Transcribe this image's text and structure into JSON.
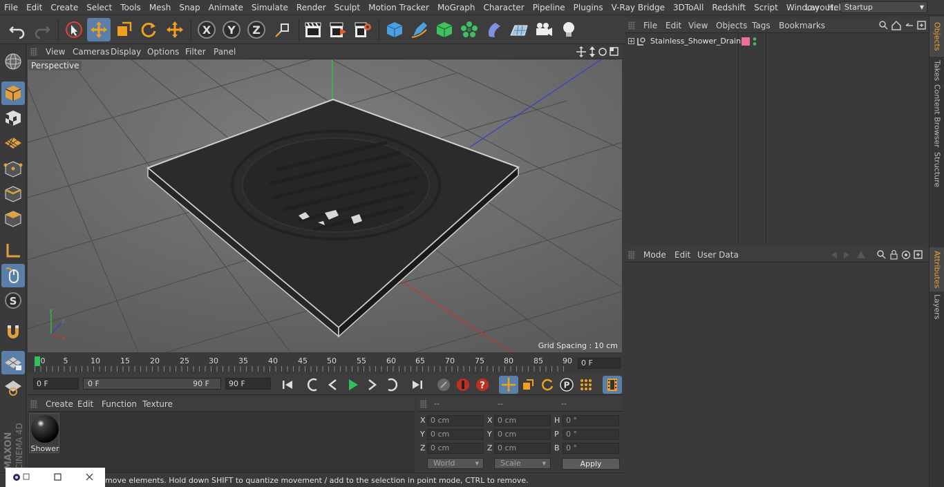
{
  "menu": [
    "File",
    "Edit",
    "Create",
    "Select",
    "Tools",
    "Mesh",
    "Snap",
    "Animate",
    "Simulate",
    "Render",
    "Sculpt",
    "Motion Tracker",
    "MoGraph",
    "Character",
    "Pipeline",
    "Plugins",
    "V-Ray Bridge",
    "3DToAll",
    "Redshift",
    "Script",
    "Window",
    "Help"
  ],
  "layout": {
    "label": "Layout:",
    "value": "Startup"
  },
  "toolbar": {
    "undo": "undo-icon",
    "redo": "redo-icon",
    "axis_x": "X",
    "axis_y": "Y",
    "axis_z": "Z"
  },
  "viewport": {
    "menu": [
      "View",
      "Cameras",
      "Display",
      "Options",
      "Filter",
      "Panel"
    ],
    "camera_label": "Perspective",
    "grid_spacing": "Grid Spacing : 10 cm"
  },
  "timeline": {
    "ticks": [
      "0",
      "5",
      "10",
      "15",
      "20",
      "25",
      "30",
      "35",
      "40",
      "45",
      "50",
      "55",
      "60",
      "65",
      "70",
      "75",
      "80",
      "85",
      "90"
    ],
    "current_frame": "0 F"
  },
  "transport": {
    "start_field": "0 F",
    "range_start": "0 F",
    "range_end": "90 F",
    "end_field": "90 F"
  },
  "materials": {
    "menu": [
      "Create",
      "Edit",
      "Function",
      "Texture"
    ],
    "items": [
      {
        "name": "Shower"
      }
    ]
  },
  "coordinates": {
    "headers": [
      "--",
      "--",
      "--"
    ],
    "rows": [
      {
        "l1": "X",
        "v1": "0 cm",
        "l2": "X",
        "v2": "0 cm",
        "l3": "H",
        "v3": "0 °"
      },
      {
        "l1": "Y",
        "v1": "0 cm",
        "l2": "Y",
        "v2": "0 cm",
        "l3": "P",
        "v3": "0 °"
      },
      {
        "l1": "Z",
        "v1": "0 cm",
        "l2": "Z",
        "v2": "0 cm",
        "l3": "B",
        "v3": "0 °"
      }
    ],
    "space": "World",
    "mode": "Scale",
    "apply": "Apply"
  },
  "status": "move elements. Hold down SHIFT to quantize movement / add to the selection in point mode, CTRL to remove.",
  "objects": {
    "menu": [
      "File",
      "Edit",
      "View",
      "Objects",
      "Tags",
      "Bookmarks"
    ],
    "items": [
      {
        "name": "Stainless_Shower_Drain",
        "tag_color": "#e8709a"
      }
    ]
  },
  "attributes": {
    "menu": [
      "Mode",
      "Edit",
      "User Data"
    ]
  },
  "right_tabs": [
    "Objects",
    "Takes",
    "Content Browser",
    "Structure",
    "Attributes",
    "Layers"
  ],
  "brand": {
    "line1": "MAXON",
    "line2": "CINEMA 4D"
  },
  "colors": {
    "accent": "#5a7fa8",
    "axis_x": "#c0392b",
    "axis_y": "#2ecc40",
    "axis_z": "#3040d0",
    "active_tab": "#f0a030"
  }
}
